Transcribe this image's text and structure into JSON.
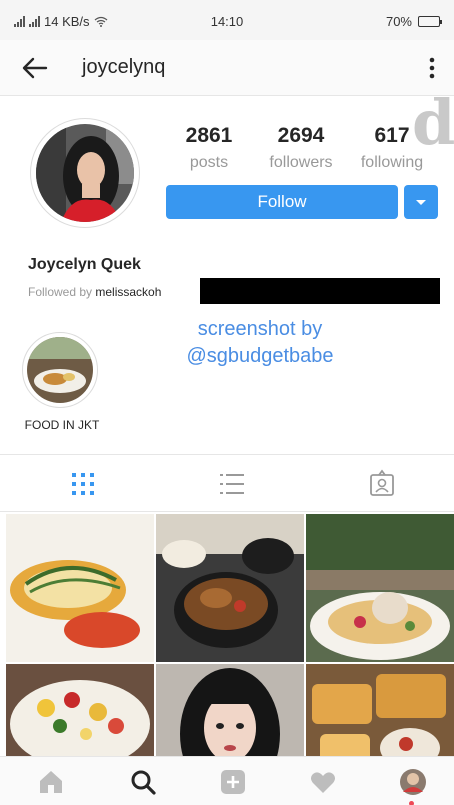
{
  "status_bar": {
    "network": "14 KB/s",
    "time": "14:10",
    "battery": "70%",
    "battery_level": 0.7
  },
  "top_bar": {
    "username": "joycelynq"
  },
  "watermark_letter": "d",
  "profile": {
    "stats": [
      {
        "value": "2861",
        "label": "posts"
      },
      {
        "value": "2694",
        "label": "followers"
      },
      {
        "value": "617",
        "label": "following"
      }
    ],
    "follow_label": "Follow",
    "full_name": "Joycelyn Quek",
    "followed_by_prefix": "Followed by",
    "followed_by_user": "melissackoh"
  },
  "screenshot_caption": {
    "line1": "screenshot by",
    "line2": "@sgbudgetbabe"
  },
  "highlights": [
    {
      "label": "FOOD IN JKT"
    }
  ],
  "tabs": [
    "grid-icon",
    "list-icon",
    "tagged-icon"
  ],
  "active_tab": "grid",
  "posts": [
    {
      "subject": "grilled-fish-on-sauce"
    },
    {
      "subject": "noodles-in-black-bowl"
    },
    {
      "subject": "tart-with-gelato"
    },
    {
      "subject": "salad-plate"
    },
    {
      "subject": "selfie-portrait"
    },
    {
      "subject": "toast-board"
    }
  ],
  "bottom_nav": [
    "home-icon",
    "search-icon",
    "add-post-icon",
    "activity-heart-icon",
    "profile-avatar-icon"
  ],
  "colors": {
    "accent": "#3897f0",
    "caption": "#4a8de3",
    "notification": "#ed4956"
  }
}
